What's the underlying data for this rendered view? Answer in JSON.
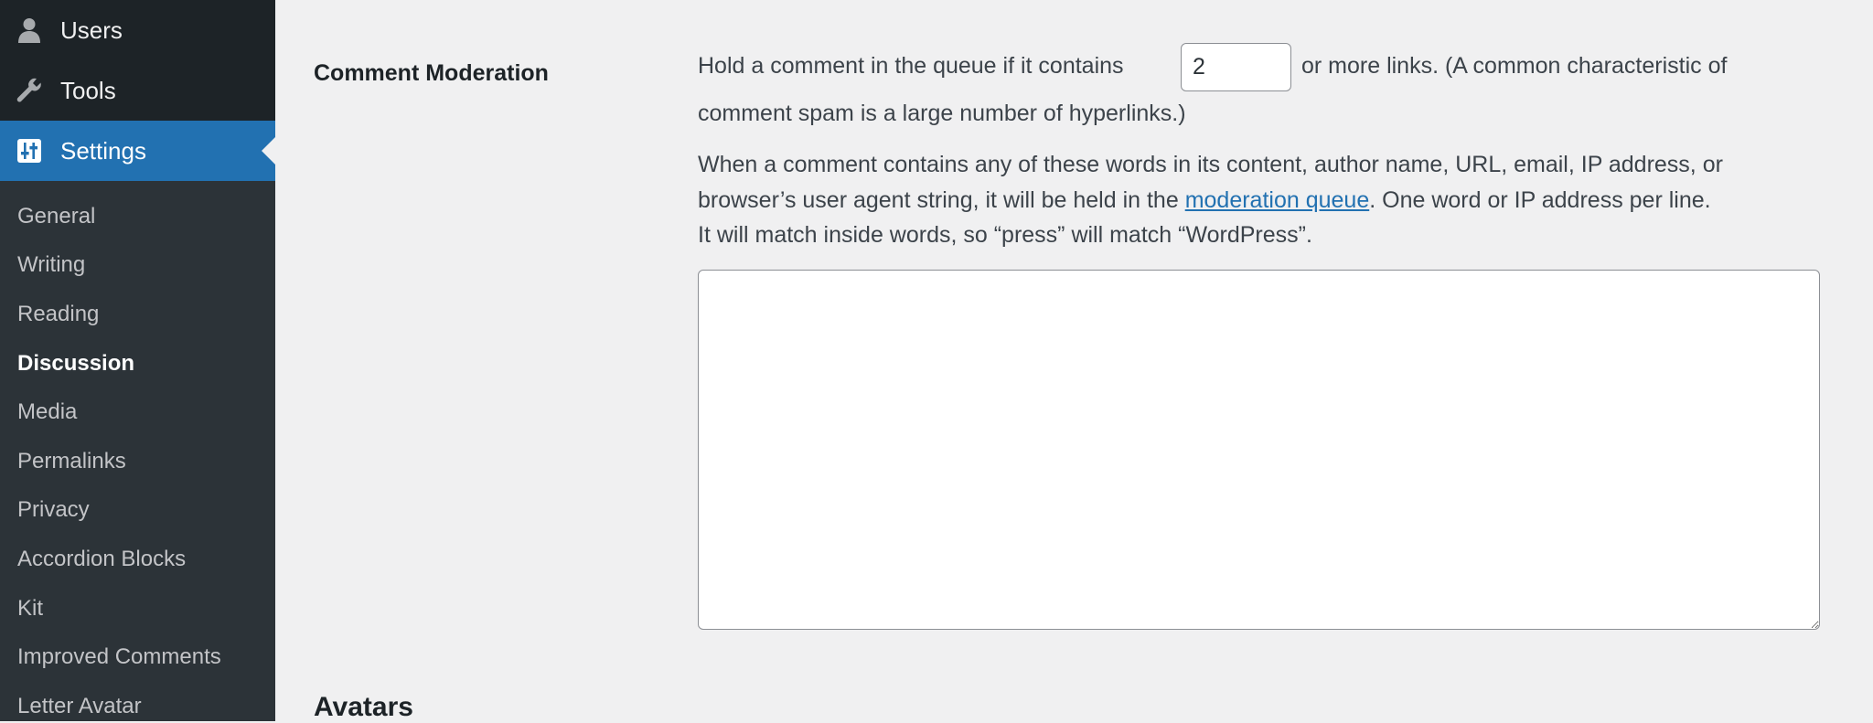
{
  "sidebar": {
    "top_items": [
      {
        "label": "Users",
        "icon": "user-icon"
      },
      {
        "label": "Tools",
        "icon": "wrench-icon"
      },
      {
        "label": "Settings",
        "icon": "settings-sliders-icon"
      }
    ],
    "submenu": [
      {
        "label": "General"
      },
      {
        "label": "Writing"
      },
      {
        "label": "Reading"
      },
      {
        "label": "Discussion",
        "current": true
      },
      {
        "label": "Media"
      },
      {
        "label": "Permalinks"
      },
      {
        "label": "Privacy"
      },
      {
        "label": "Accordion Blocks"
      },
      {
        "label": "Kit"
      },
      {
        "label": "Improved Comments"
      },
      {
        "label": "Letter Avatar"
      }
    ]
  },
  "comment_moderation": {
    "label": "Comment Moderation",
    "links_prefix": "Hold a comment in the queue if it contains",
    "links_value": "2",
    "links_suffix": "or more links. (A common characteristic of",
    "links_line2": "comment spam is a large number of hyperlinks.)",
    "words_line1": "When a comment contains any of these words in its content, author name, URL, email, IP address, or",
    "words_line2_prefix": "browser’s user agent string, it will be held in the",
    "words_link": "moderation queue",
    "words_line2_suffix": ". One word or IP address per line.",
    "words_line3": "It will match inside words, so “press” will match “WordPress”.",
    "textarea_value": ""
  },
  "avatars": {
    "heading": "Avatars"
  },
  "colors": {
    "sidebar_bg": "#1d2327",
    "submenu_bg": "#2c3338",
    "accent": "#2271b1",
    "page_bg": "#f0f0f1"
  }
}
